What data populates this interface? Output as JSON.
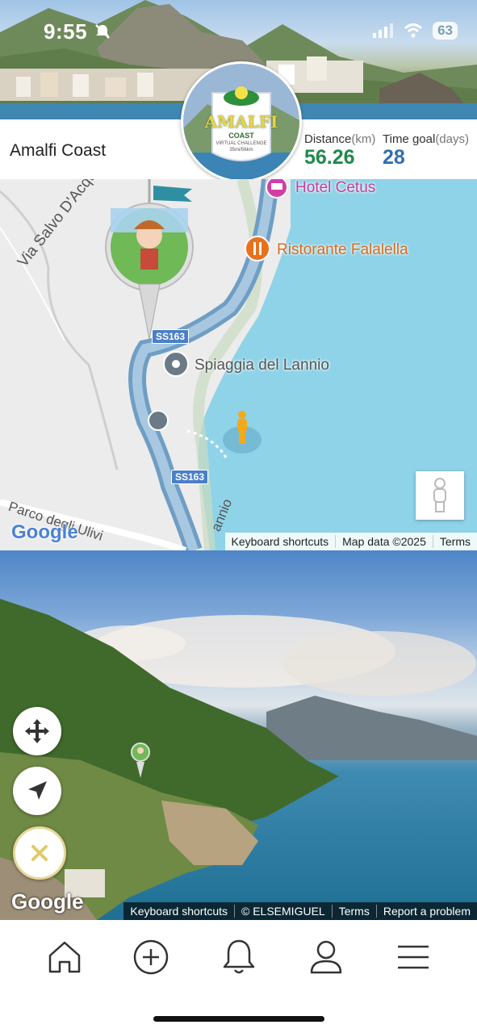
{
  "status_bar": {
    "time": "9:55",
    "battery": "63"
  },
  "header": {
    "route_name": "Amalfi Coast",
    "badge": {
      "title": "AMALFI",
      "subtitle": "COAST",
      "line1": "VIRTUAL CHALLENGE",
      "line2": "35mi/56km"
    },
    "distance": {
      "label": "Distance",
      "unit": "(km)",
      "value": "56.26"
    },
    "time_goal": {
      "label": "Time goal",
      "unit": "(days)",
      "value": "28"
    },
    "colors": {
      "distance_value": "#1f8a4c",
      "time_goal_value": "#2f6fb3"
    }
  },
  "map": {
    "road_label": "Via Salvo D'Acquisto",
    "road_label_2": "Parco degli Ulivi",
    "road_label_3": "annio",
    "shield_1": "SS163",
    "shield_2": "SS163",
    "pois": [
      {
        "name": "Hotel Cetus",
        "icon": "hotel-icon",
        "color": "#d13fa6"
      },
      {
        "name": "Ristorante Falalella",
        "icon": "restaurant-icon",
        "color": "#e8711c"
      },
      {
        "name": "Spiaggia del Lannio",
        "icon": "place-pin-icon",
        "color": "#555555"
      }
    ],
    "google_logo": "Google",
    "attribution": {
      "shortcuts": "Keyboard shortcuts",
      "data": "Map data ©2025",
      "terms": "Terms"
    }
  },
  "streetview": {
    "google_logo": "Google",
    "attribution": {
      "shortcuts": "Keyboard shortcuts",
      "author": "© ELSEMIGUEL",
      "terms": "Terms",
      "report": "Report a problem"
    }
  },
  "bottom_nav": [
    {
      "icon": "home-icon"
    },
    {
      "icon": "add-circle-icon"
    },
    {
      "icon": "bell-icon"
    },
    {
      "icon": "profile-icon"
    },
    {
      "icon": "menu-icon"
    }
  ]
}
